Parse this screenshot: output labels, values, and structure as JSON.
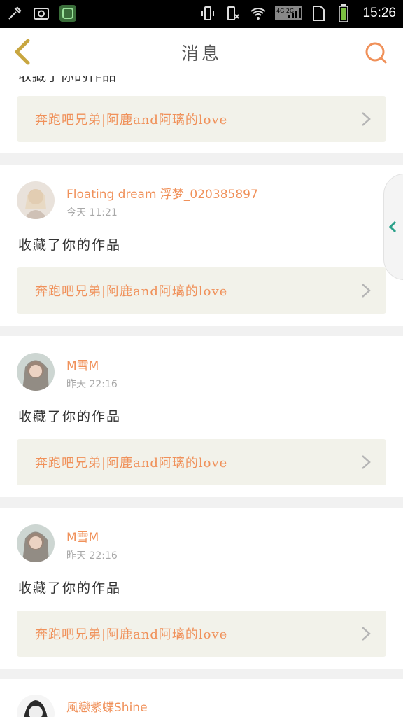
{
  "status_bar": {
    "icons_left": [
      "tools-icon",
      "screenshot-icon",
      "app-icon"
    ],
    "icons_right": [
      "vibrate-icon",
      "silent-icon",
      "wifi-icon",
      "signal-icon",
      "sim-icon",
      "battery-icon"
    ],
    "network_label": "4G 2G",
    "time": "15:26"
  },
  "header": {
    "title": "消息"
  },
  "top_card": {
    "work_title": "奔跑吧兄弟|阿鹿and阿璃的love"
  },
  "messages": [
    {
      "user": "Floating dream 浮梦_020385897",
      "time": "今天 11:21",
      "action": "收藏了你的作品",
      "work_title": "奔跑吧兄弟|阿鹿and阿璃的love"
    },
    {
      "user": "M雪M",
      "time": "昨天 22:16",
      "action": "收藏了你的作品",
      "work_title": "奔跑吧兄弟|阿鹿and阿璃的love"
    },
    {
      "user": "M雪M",
      "time": "昨天 22:16",
      "action": "收藏了你的作品",
      "work_title": "奔跑吧兄弟|阿鹿and阿璃的love"
    },
    {
      "user": "風戀紫蝶Shine"
    }
  ],
  "colors": {
    "accent": "#f0915a",
    "back_arrow": "#c8a640",
    "card_bg": "#f2f2ea",
    "page_bg": "#f1f1f1"
  }
}
